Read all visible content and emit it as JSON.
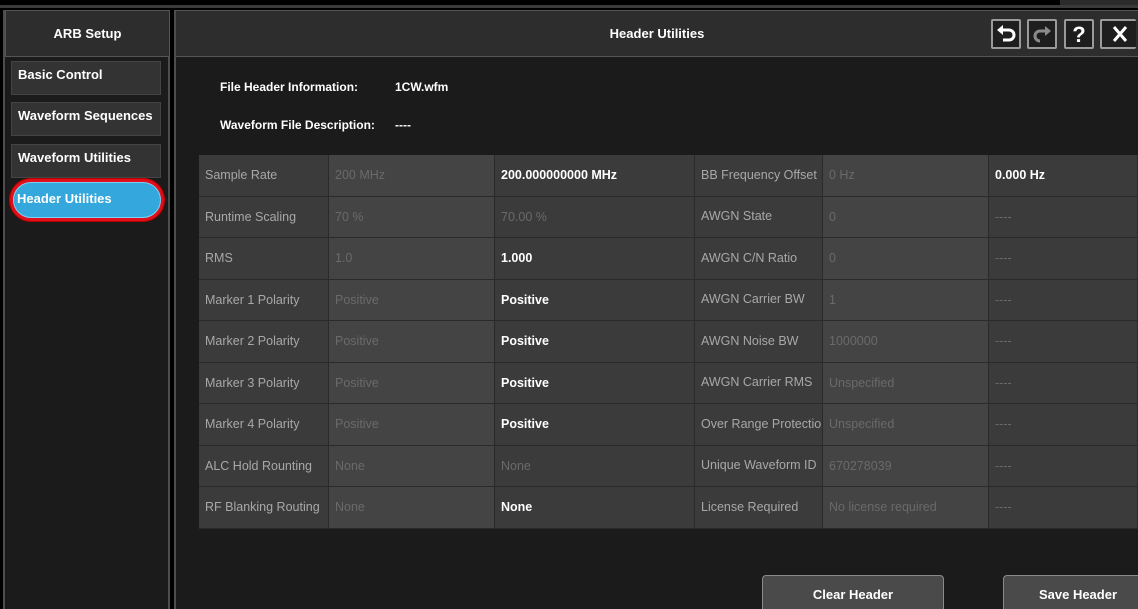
{
  "left_panel": {
    "title": "ARB Setup",
    "items": [
      {
        "label": "Basic Control"
      },
      {
        "label": "Waveform Sequences"
      },
      {
        "label": "Waveform Utilities"
      },
      {
        "label": "Header Utilities"
      }
    ]
  },
  "main": {
    "title": "Header Utilities",
    "file_header_label": "File Header Information:",
    "file_header_value": "1CW.wfm",
    "description_label": "Waveform File Description:",
    "description_value": "----"
  },
  "table": {
    "left_rows": [
      {
        "label": "Sample Rate",
        "current": "200 MHz",
        "new": "200.000000000 MHz",
        "new_bold": true
      },
      {
        "label": "Runtime Scaling",
        "current": "70 %",
        "new": "70.00 %",
        "new_bold": false
      },
      {
        "label": "RMS",
        "current": "1.0",
        "new": "1.000",
        "new_bold": true
      },
      {
        "label": "Marker 1 Polarity",
        "current": "Positive",
        "new": "Positive",
        "new_bold": true
      },
      {
        "label": "Marker 2 Polarity",
        "current": "Positive",
        "new": "Positive",
        "new_bold": true
      },
      {
        "label": "Marker 3 Polarity",
        "current": "Positive",
        "new": "Positive",
        "new_bold": true
      },
      {
        "label": "Marker 4 Polarity",
        "current": "Positive",
        "new": "Positive",
        "new_bold": true
      },
      {
        "label": "ALC Hold Rounting",
        "current": "None",
        "new": "None",
        "new_bold": false
      },
      {
        "label": "RF Blanking Routing",
        "current": "None",
        "new": "None",
        "new_bold": true
      }
    ],
    "right_rows": [
      {
        "label": "BB Frequency Offset",
        "current": "0 Hz",
        "new": "0.000 Hz",
        "new_bold": true
      },
      {
        "label": "AWGN State",
        "current": "0",
        "new": "----",
        "new_bold": false
      },
      {
        "label": "AWGN C/N Ratio",
        "current": "0",
        "new": "----",
        "new_bold": false
      },
      {
        "label": "AWGN Carrier BW",
        "current": "1",
        "new": "----",
        "new_bold": false
      },
      {
        "label": "AWGN Noise BW",
        "current": "1000000",
        "new": "----",
        "new_bold": false
      },
      {
        "label": "AWGN Carrier RMS",
        "current": "Unspecified",
        "new": "----",
        "new_bold": false
      },
      {
        "label": "Over Range Protection",
        "current": "Unspecified",
        "new": "----",
        "new_bold": false
      },
      {
        "label": "Unique Waveform ID",
        "current": "670278039",
        "new": "----",
        "new_bold": false
      },
      {
        "label": "License Required",
        "current": "No license required",
        "new": "----",
        "new_bold": false
      }
    ]
  },
  "buttons": {
    "clear": "Clear Header",
    "save": "Save Header"
  },
  "toolbar": {
    "icons": [
      "undo-icon",
      "redo-icon",
      "help-icon",
      "close-icon"
    ]
  },
  "colors": {
    "accent": "#34a7dc",
    "highlight_ring": "#e0101a"
  }
}
